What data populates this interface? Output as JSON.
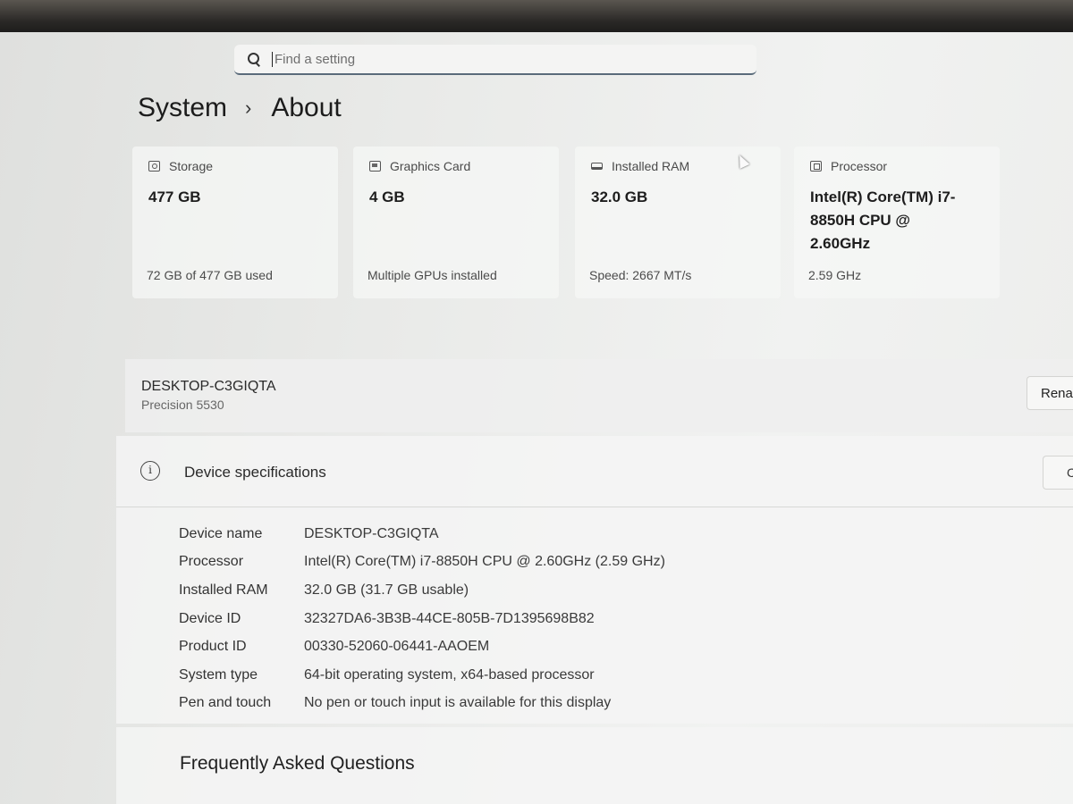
{
  "search": {
    "placeholder": "Find a setting"
  },
  "breadcrumb": {
    "parent": "System",
    "separator": "›",
    "current": "About"
  },
  "cards": [
    {
      "icon": "storage-icon",
      "title": "Storage",
      "value": "477 GB",
      "sub": "72 GB of 477 GB used"
    },
    {
      "icon": "graphics-card-icon",
      "title": "Graphics Card",
      "value": "4 GB",
      "sub": "Multiple GPUs installed"
    },
    {
      "icon": "ram-icon",
      "title": "Installed RAM",
      "value": "32.0 GB",
      "sub": "Speed: 2667 MT/s"
    },
    {
      "icon": "processor-icon",
      "title": "Processor",
      "value": "Intel(R) Core(TM) i7-8850H CPU @ 2.60GHz",
      "sub": "2.59 GHz"
    }
  ],
  "device": {
    "name": "DESKTOP-C3GIQTA",
    "model": "Precision 5530",
    "rename_label": "Rename this PC"
  },
  "specs": {
    "icon": "info-icon",
    "title": "Device specifications",
    "copy_label": "Copy",
    "rows": [
      {
        "label": "Device name",
        "value": "DESKTOP-C3GIQTA"
      },
      {
        "label": "Processor",
        "value": "Intel(R) Core(TM) i7-8850H CPU @ 2.60GHz (2.59 GHz)"
      },
      {
        "label": "Installed RAM",
        "value": "32.0 GB (31.7 GB usable)"
      },
      {
        "label": "Device ID",
        "value": "32327DA6-3B3B-44CE-805B-7D1395698B82"
      },
      {
        "label": "Product ID",
        "value": "00330-52060-06441-AAOEM"
      },
      {
        "label": "System type",
        "value": "64-bit operating system, x64-based processor"
      },
      {
        "label": "Pen and touch",
        "value": "No pen or touch input is available for this display"
      }
    ]
  },
  "faq": {
    "title": "Frequently Asked Questions"
  },
  "colors": {
    "search_underline": "#5a6b7a",
    "card_bg": "#f6f7f6",
    "panel_bg": "#f4f5f4"
  }
}
